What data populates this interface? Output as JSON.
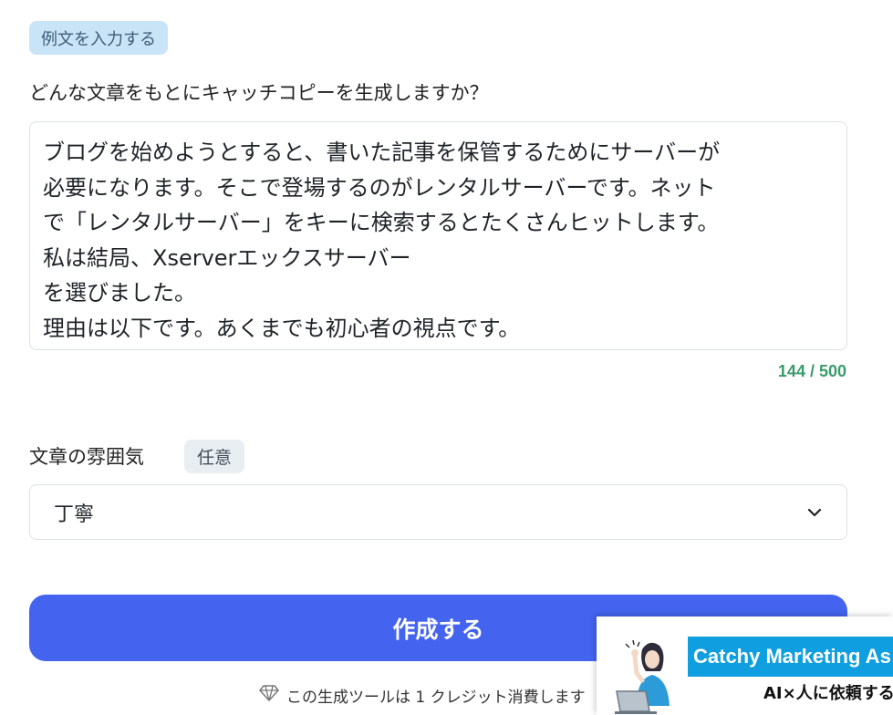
{
  "example_button": {
    "label": "例文を入力する"
  },
  "source_text": {
    "question": "どんな文章をもとにキャッチコピーを生成しますか？",
    "value": "ブログを始めようとすると、書いた記事を保管するためにサーバーが\n必要になります。そこで登場するのがレンタルサーバーです。ネット\nで「レンタルサーバー」をキーに検索するとたくさんヒットします。\n私は結局、Xserverエックスサーバー\nを選びました。\n理由は以下です。あくまでも初心者の視点です。",
    "counter": "144 / 500"
  },
  "mood": {
    "label": "文章の雰囲気",
    "badge": "任意",
    "selected": "丁寧",
    "icon": "chevron-down-icon"
  },
  "create_button": {
    "label": "作成する"
  },
  "credit_note": {
    "text": "この生成ツールは 1 クレジット消費します",
    "icon": "diamond-icon"
  },
  "ad": {
    "title": "Catchy Marketing As",
    "subtitle": "AI×人に依頼する"
  },
  "colors": {
    "primary_button": "#4464f0",
    "counter": "#3a9b6a",
    "example_button_bg": "#c9e4f7",
    "ad_blue": "#0f9fe0"
  }
}
